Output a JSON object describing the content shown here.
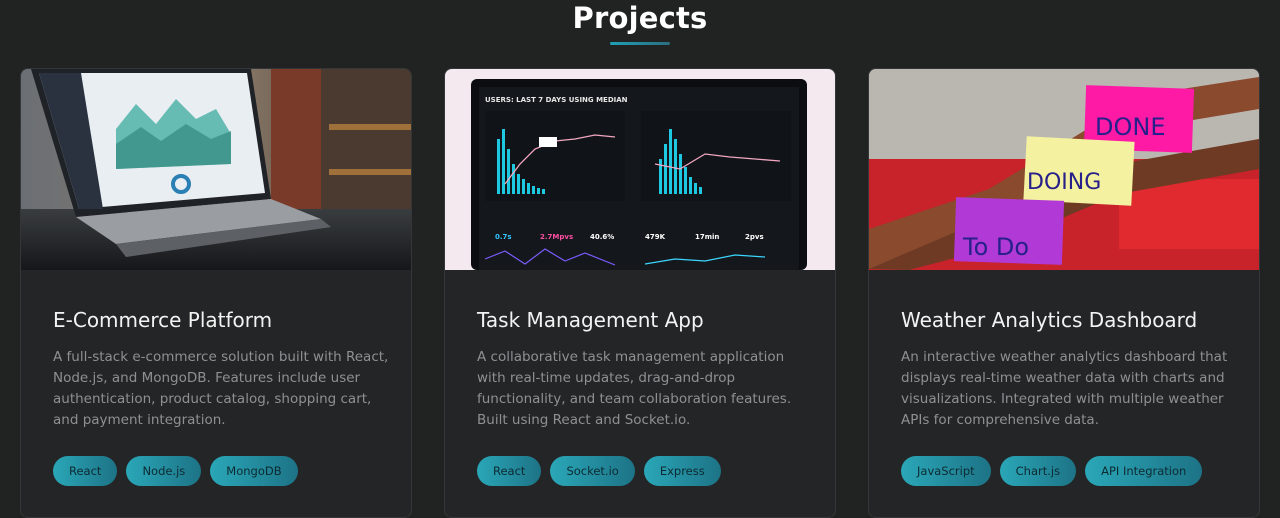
{
  "section": {
    "title": "Projects"
  },
  "projects": [
    {
      "title": "E-Commerce Platform",
      "description": "A full-stack e-commerce solution built with React, Node.js, and MongoDB. Features include user authentication, product catalog, shopping cart, and payment integration.",
      "tags": [
        "React",
        "Node.js",
        "MongoDB"
      ],
      "image": "laptop-analytics-dashboard-photo"
    },
    {
      "title": "Task Management App",
      "description": "A collaborative task management application with real-time updates, drag-and-drop functionality, and team collaboration features. Built using React and Socket.io.",
      "tags": [
        "React",
        "Socket.io",
        "Express"
      ],
      "image": "monitor-analytics-charts-photo",
      "screen": {
        "header": "USERS: LAST 7 DAYS USING MEDIAN",
        "metric_1": "0.7s",
        "metric_2": "2.7Mpvs",
        "metric_3": "40.6%",
        "metric_4": "479K",
        "metric_5": "17min",
        "metric_6": "2pvs"
      }
    },
    {
      "title": "Weather Analytics Dashboard",
      "description": "An interactive weather analytics dashboard that displays real-time weather data with charts and visualizations. Integrated with multiple weather APIs for comprehensive data.",
      "tags": [
        "JavaScript",
        "Chart.js",
        "API Integration"
      ],
      "image": "sticky-notes-kanban-photo",
      "notes": {
        "done": "DONE",
        "doing": "DOING",
        "todo": "To Do"
      }
    }
  ]
}
